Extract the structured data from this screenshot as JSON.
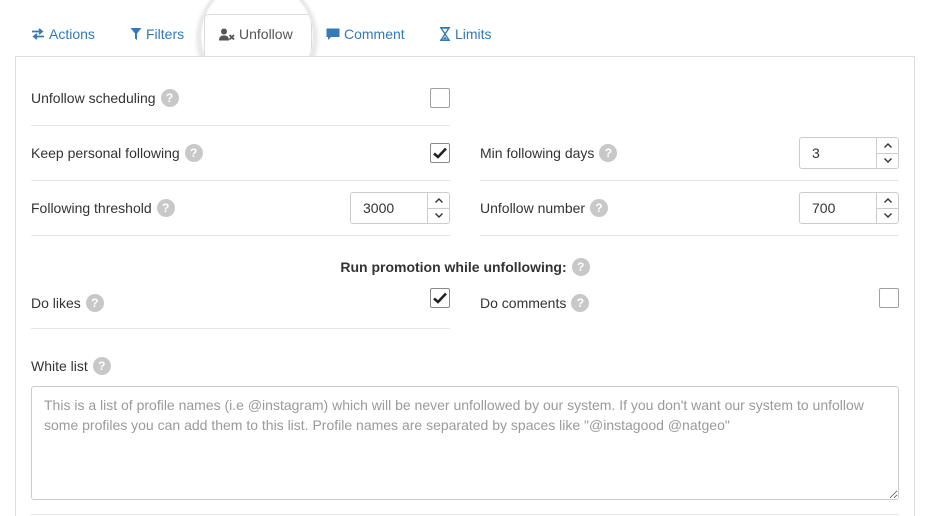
{
  "tabs": [
    {
      "label": "Actions",
      "icon": "exchange-icon"
    },
    {
      "label": "Filters",
      "icon": "filter-icon"
    },
    {
      "label": "Unfollow",
      "icon": "user-times-icon",
      "active": true
    },
    {
      "label": "Comment",
      "icon": "comment-icon"
    },
    {
      "label": "Limits",
      "icon": "hourglass-icon"
    }
  ],
  "colors": {
    "link": "#337ab7",
    "help": "#c8c8c8",
    "border": "#dddddd"
  },
  "fields": {
    "unfollow_scheduling": {
      "label": "Unfollow scheduling",
      "checked": false
    },
    "keep_personal_following": {
      "label": "Keep personal following",
      "checked": true
    },
    "min_following_days": {
      "label": "Min following days",
      "value": "3"
    },
    "following_threshold": {
      "label": "Following threshold",
      "value": "3000"
    },
    "unfollow_number": {
      "label": "Unfollow number",
      "value": "700"
    }
  },
  "promotion": {
    "title": "Run promotion while unfollowing:",
    "do_likes": {
      "label": "Do likes",
      "checked": true
    },
    "do_comments": {
      "label": "Do comments",
      "checked": false
    }
  },
  "whitelist": {
    "label": "White list",
    "placeholder": "This is a list of profile names (i.e @instagram) which will be never unfollowed by our system. If you don't want our system to unfollow some profiles you can add them to this list. Profile names are separated by spaces like \"@instagood @natgeo\"",
    "value": ""
  },
  "help_glyph": "?"
}
